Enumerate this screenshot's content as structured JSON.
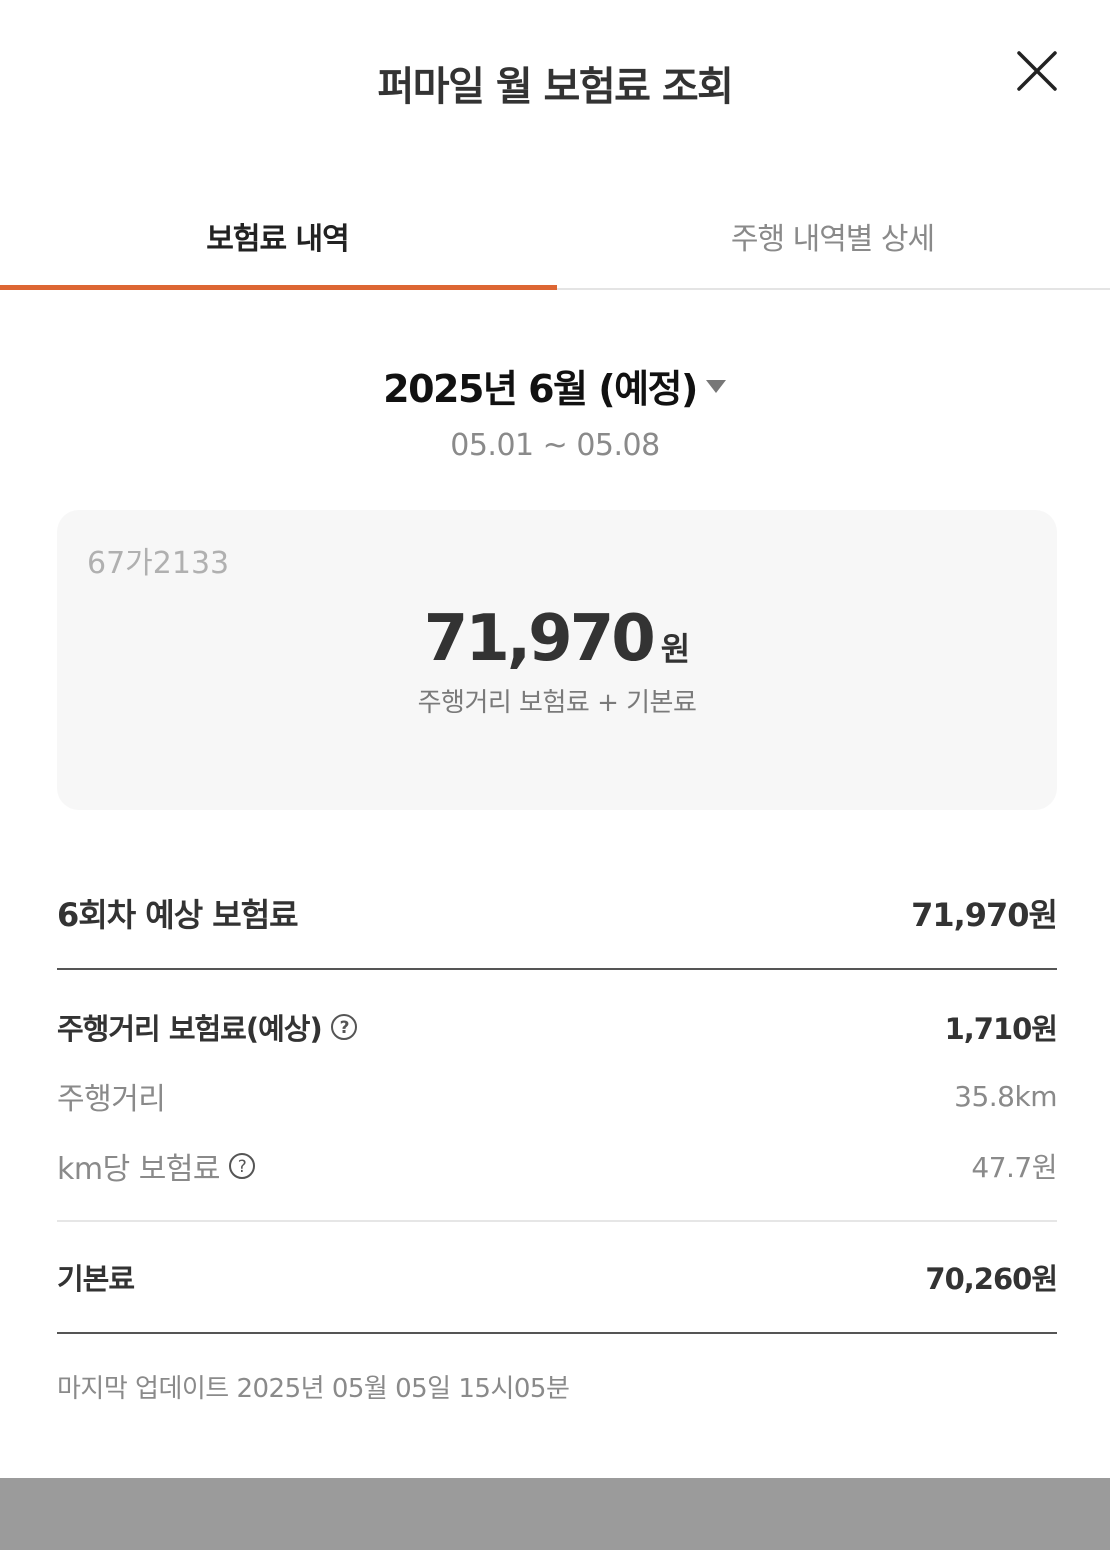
{
  "header": {
    "title": "퍼마일 월 보험료 조회",
    "close_icon": "close-icon"
  },
  "tabs": [
    {
      "label": "보험료 내역",
      "active": true
    },
    {
      "label": "주행 내역별 상세",
      "active": false
    }
  ],
  "colors": {
    "accent": "#dd6633",
    "card_bg": "#f7f7f7",
    "bottom_bar": "#9b9b9b"
  },
  "period": {
    "label": "2025년 6월 (예정)",
    "range": "05.01 ~ 05.08",
    "dropdown_icon": "caret-down-icon"
  },
  "summary_card": {
    "plate": "67가2133",
    "amount": "71,970",
    "unit": "원",
    "description": "주행거리 보험료 + 기본료"
  },
  "details": {
    "estimated": {
      "label": "6회차 예상 보험료",
      "value": "71,970원"
    },
    "distance_premium": {
      "label": "주행거리 보험료(예상)",
      "value": "1,710원",
      "icon": "help-icon"
    },
    "distance": {
      "label": "주행거리",
      "value": "35.8km"
    },
    "per_km": {
      "label": "km당 보험료",
      "value": "47.7원",
      "icon": "help-icon"
    },
    "base_fee": {
      "label": "기본료",
      "value": "70,260원"
    }
  },
  "footer": {
    "updated": "마지막 업데이트 2025년 05월 05일 15시05분"
  }
}
